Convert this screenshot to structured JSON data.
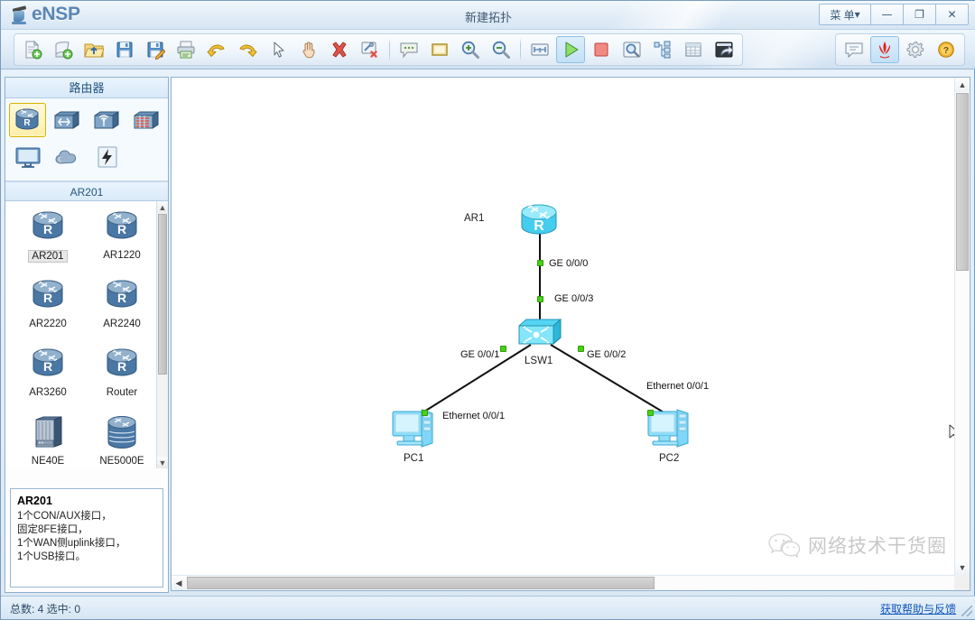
{
  "window": {
    "brand": "eNSP",
    "title": "新建拓扑",
    "menu_label": "菜 单",
    "menu_caret": "▾",
    "minimize": "—",
    "maximize": "❐",
    "close": "✕"
  },
  "toolbar": {
    "buttons": [
      {
        "name": "new-topology-button",
        "label": "新建拓扑"
      },
      {
        "name": "new-device-button",
        "label": "新建设备"
      },
      {
        "name": "open-button",
        "label": "打开"
      },
      {
        "name": "save-button",
        "label": "保存"
      },
      {
        "name": "save-as-button",
        "label": "另存为"
      },
      {
        "name": "print-button",
        "label": "打印"
      },
      {
        "name": "undo-button",
        "label": "撤销"
      },
      {
        "name": "redo-button",
        "label": "重做"
      },
      {
        "name": "select-tool-button",
        "label": "选择"
      },
      {
        "name": "hand-tool-button",
        "label": "移动画布"
      },
      {
        "name": "delete-button",
        "label": "删除"
      },
      {
        "name": "delete-link-button",
        "label": "删除连线"
      },
      {
        "name": "add-note-button",
        "label": "添加描述"
      },
      {
        "name": "add-shape-button",
        "label": "添加图形"
      },
      {
        "name": "zoom-in-button",
        "label": "放大"
      },
      {
        "name": "zoom-out-button",
        "label": "缩小"
      },
      {
        "name": "zoom-reset-button",
        "label": "恢复比例"
      },
      {
        "name": "start-all-button",
        "label": "开启设备"
      },
      {
        "name": "stop-all-button",
        "label": "关闭设备"
      },
      {
        "name": "capture-button",
        "label": "数据抓包"
      },
      {
        "name": "topology-tree-button",
        "label": "拓扑树"
      },
      {
        "name": "grid-button",
        "label": "网格"
      },
      {
        "name": "restore-window-button",
        "label": "还原窗口"
      }
    ],
    "right_buttons": [
      {
        "name": "feedback-icon",
        "label": "意见反馈"
      },
      {
        "name": "huawei-logo-icon",
        "label": "华为"
      },
      {
        "name": "settings-gear-icon",
        "label": "设置"
      },
      {
        "name": "help-icon",
        "label": "帮助"
      }
    ]
  },
  "sidebar": {
    "category_header": "路由器",
    "categories": [
      {
        "name": "category-router",
        "label": "路由器",
        "selected": true
      },
      {
        "name": "category-switch",
        "label": "交换机",
        "selected": false
      },
      {
        "name": "category-wlan",
        "label": "无线局域网",
        "selected": false
      },
      {
        "name": "category-firewall",
        "label": "防火墙",
        "selected": false
      },
      {
        "name": "category-terminal",
        "label": "终端",
        "selected": false
      },
      {
        "name": "category-cloud",
        "label": "其他设备",
        "selected": false
      },
      {
        "name": "category-connection",
        "label": "设备连线",
        "selected": false
      }
    ],
    "model_header": "AR201",
    "models": [
      {
        "name": "device-ar201",
        "label": "AR201",
        "selected": true,
        "icon": "router-icon"
      },
      {
        "name": "device-ar1220",
        "label": "AR1220",
        "selected": false,
        "icon": "router-icon"
      },
      {
        "name": "device-ar2220",
        "label": "AR2220",
        "selected": false,
        "icon": "router-icon"
      },
      {
        "name": "device-ar2240",
        "label": "AR2240",
        "selected": false,
        "icon": "router-icon"
      },
      {
        "name": "device-ar3260",
        "label": "AR3260",
        "selected": false,
        "icon": "router-icon"
      },
      {
        "name": "device-router",
        "label": "Router",
        "selected": false,
        "icon": "router-icon"
      },
      {
        "name": "device-ne40e",
        "label": "NE40E",
        "selected": false,
        "icon": "chassis-icon"
      },
      {
        "name": "device-ne5000e",
        "label": "NE5000E",
        "selected": false,
        "icon": "bigrouter-icon"
      }
    ],
    "description": {
      "title": "AR201",
      "lines": [
        "1个CON/AUX接口，",
        "固定8FE接口，",
        "1个WAN侧uplink接口，",
        "1个USB接口。"
      ]
    }
  },
  "canvas": {
    "nodes": [
      {
        "name": "node-ar1",
        "label": "AR1",
        "type": "router"
      },
      {
        "name": "node-lsw1",
        "label": "LSW1",
        "type": "switch"
      },
      {
        "name": "node-pc1",
        "label": "PC1",
        "type": "pc"
      },
      {
        "name": "node-pc2",
        "label": "PC2",
        "type": "pc"
      }
    ],
    "interfaces": [
      {
        "name": "iface-ar1-ge0-0-0",
        "label": "GE 0/0/0"
      },
      {
        "name": "iface-lsw1-ge0-0-3",
        "label": "GE 0/0/3"
      },
      {
        "name": "iface-lsw1-ge0-0-1",
        "label": "GE 0/0/1"
      },
      {
        "name": "iface-lsw1-ge0-0-2",
        "label": "GE 0/0/2"
      },
      {
        "name": "iface-pc1-eth0-0-1",
        "label": "Ethernet 0/0/1"
      },
      {
        "name": "iface-pc2-eth0-0-1",
        "label": "Ethernet 0/0/1"
      }
    ],
    "watermark": "网络技术干货圈"
  },
  "statusbar": {
    "counts": "总数: 4  选中: 0",
    "help_link": "获取帮助与反馈"
  },
  "colors": {
    "accent": "#5b86b4",
    "selection": "#d9b300",
    "link_dot": "#49d016",
    "node_cyan": "#6fd6f5",
    "help_link": "#1155bb"
  }
}
